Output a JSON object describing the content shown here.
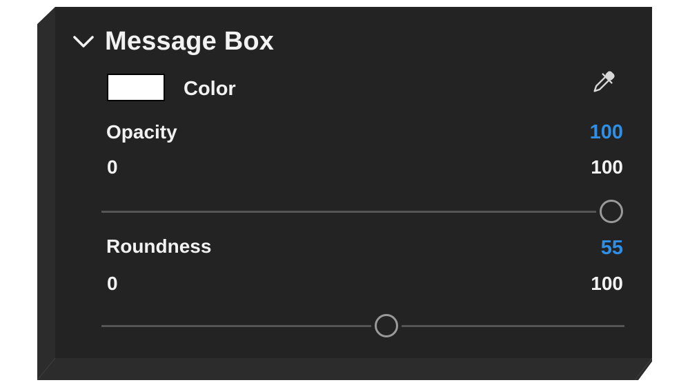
{
  "panel": {
    "title": "Message Box",
    "icons": {
      "collapse": "chevron-down-icon",
      "picker": "eyedropper-icon"
    }
  },
  "color": {
    "label": "Color",
    "swatch": "#ffffff"
  },
  "opacity": {
    "label": "Opacity",
    "value": "100",
    "min_label": "0",
    "max_label": "100",
    "min": 0,
    "max": 100,
    "current": 100
  },
  "roundness": {
    "label": "Roundness",
    "value": "55",
    "min_label": "0",
    "max_label": "100",
    "min": 0,
    "max": 100,
    "current": 55
  },
  "colors": {
    "panel_bg": "#232323",
    "text": "#f2f2f2",
    "accent": "#2f8fe6",
    "track": "#555555",
    "thumb_border": "#9a9a9a"
  }
}
